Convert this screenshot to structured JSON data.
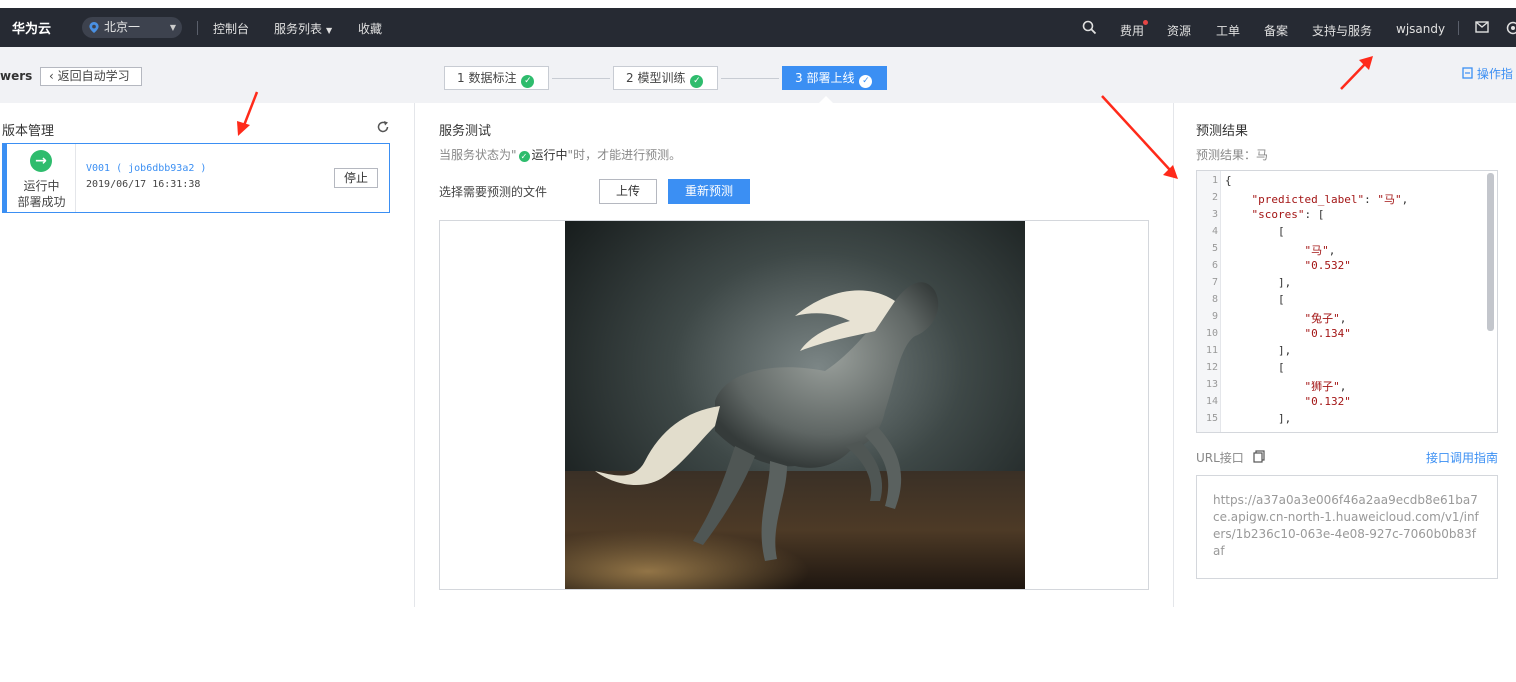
{
  "header": {
    "brand": "华为云",
    "region": "北京一",
    "nav": {
      "console": "控制台",
      "services": "服务列表",
      "favorites": "收藏"
    },
    "right": {
      "billing": "费用",
      "resources": "资源",
      "tickets": "工单",
      "icp": "备案",
      "support": "支持与服务",
      "user": "wjsandy"
    }
  },
  "subbar": {
    "crumb": "wers",
    "back": "返回自动学习",
    "steps": [
      {
        "label": "1 数据标注"
      },
      {
        "label": "2 模型训练"
      },
      {
        "label": "3 部署上线"
      }
    ],
    "guide": "操作指"
  },
  "left": {
    "title": "版本管理",
    "card": {
      "status1": "运行中",
      "status2": "部署成功",
      "version": "V001 ( job6dbb93a2 )",
      "time": "2019/06/17 16:31:38",
      "stop": "停止"
    }
  },
  "middle": {
    "title": "服务测试",
    "hint_pre": "当服务状态为\"",
    "hint_run": "运行中",
    "hint_post": "\"时，才能进行预测。",
    "select_label": "选择需要预测的文件",
    "upload": "上传",
    "repredict": "重新预测"
  },
  "right": {
    "title": "预测结果",
    "result": "预测结果：马",
    "code": {
      "line_numbers": [
        "1",
        "2",
        "3",
        "4",
        "5",
        "6",
        "7",
        "8",
        "9",
        "10",
        "11",
        "12",
        "13",
        "14",
        "15"
      ],
      "predicted_label_key": "\"predicted_label\"",
      "predicted_label_val": "\"马\"",
      "scores_key": "\"scores\"",
      "label1": "\"马\"",
      "score1": "\"0.532\"",
      "label2": "\"兔子\"",
      "score2": "\"0.134\"",
      "label3": "\"狮子\"",
      "score3": "\"0.132\""
    },
    "url_label": "URL接口",
    "api_guide": "接口调用指南",
    "url": "https://a37a0a3e006f46a2aa9ecdb8e61ba7ce.apigw.cn-north-1.huaweicloud.com/v1/infers/1b236c10-063e-4e08-927c-7060b0b83faf"
  },
  "colors": {
    "header_bg": "#262a33",
    "accent": "#3b8ff3",
    "success": "#2ebc6d",
    "annotation": "#ff2a1a"
  }
}
